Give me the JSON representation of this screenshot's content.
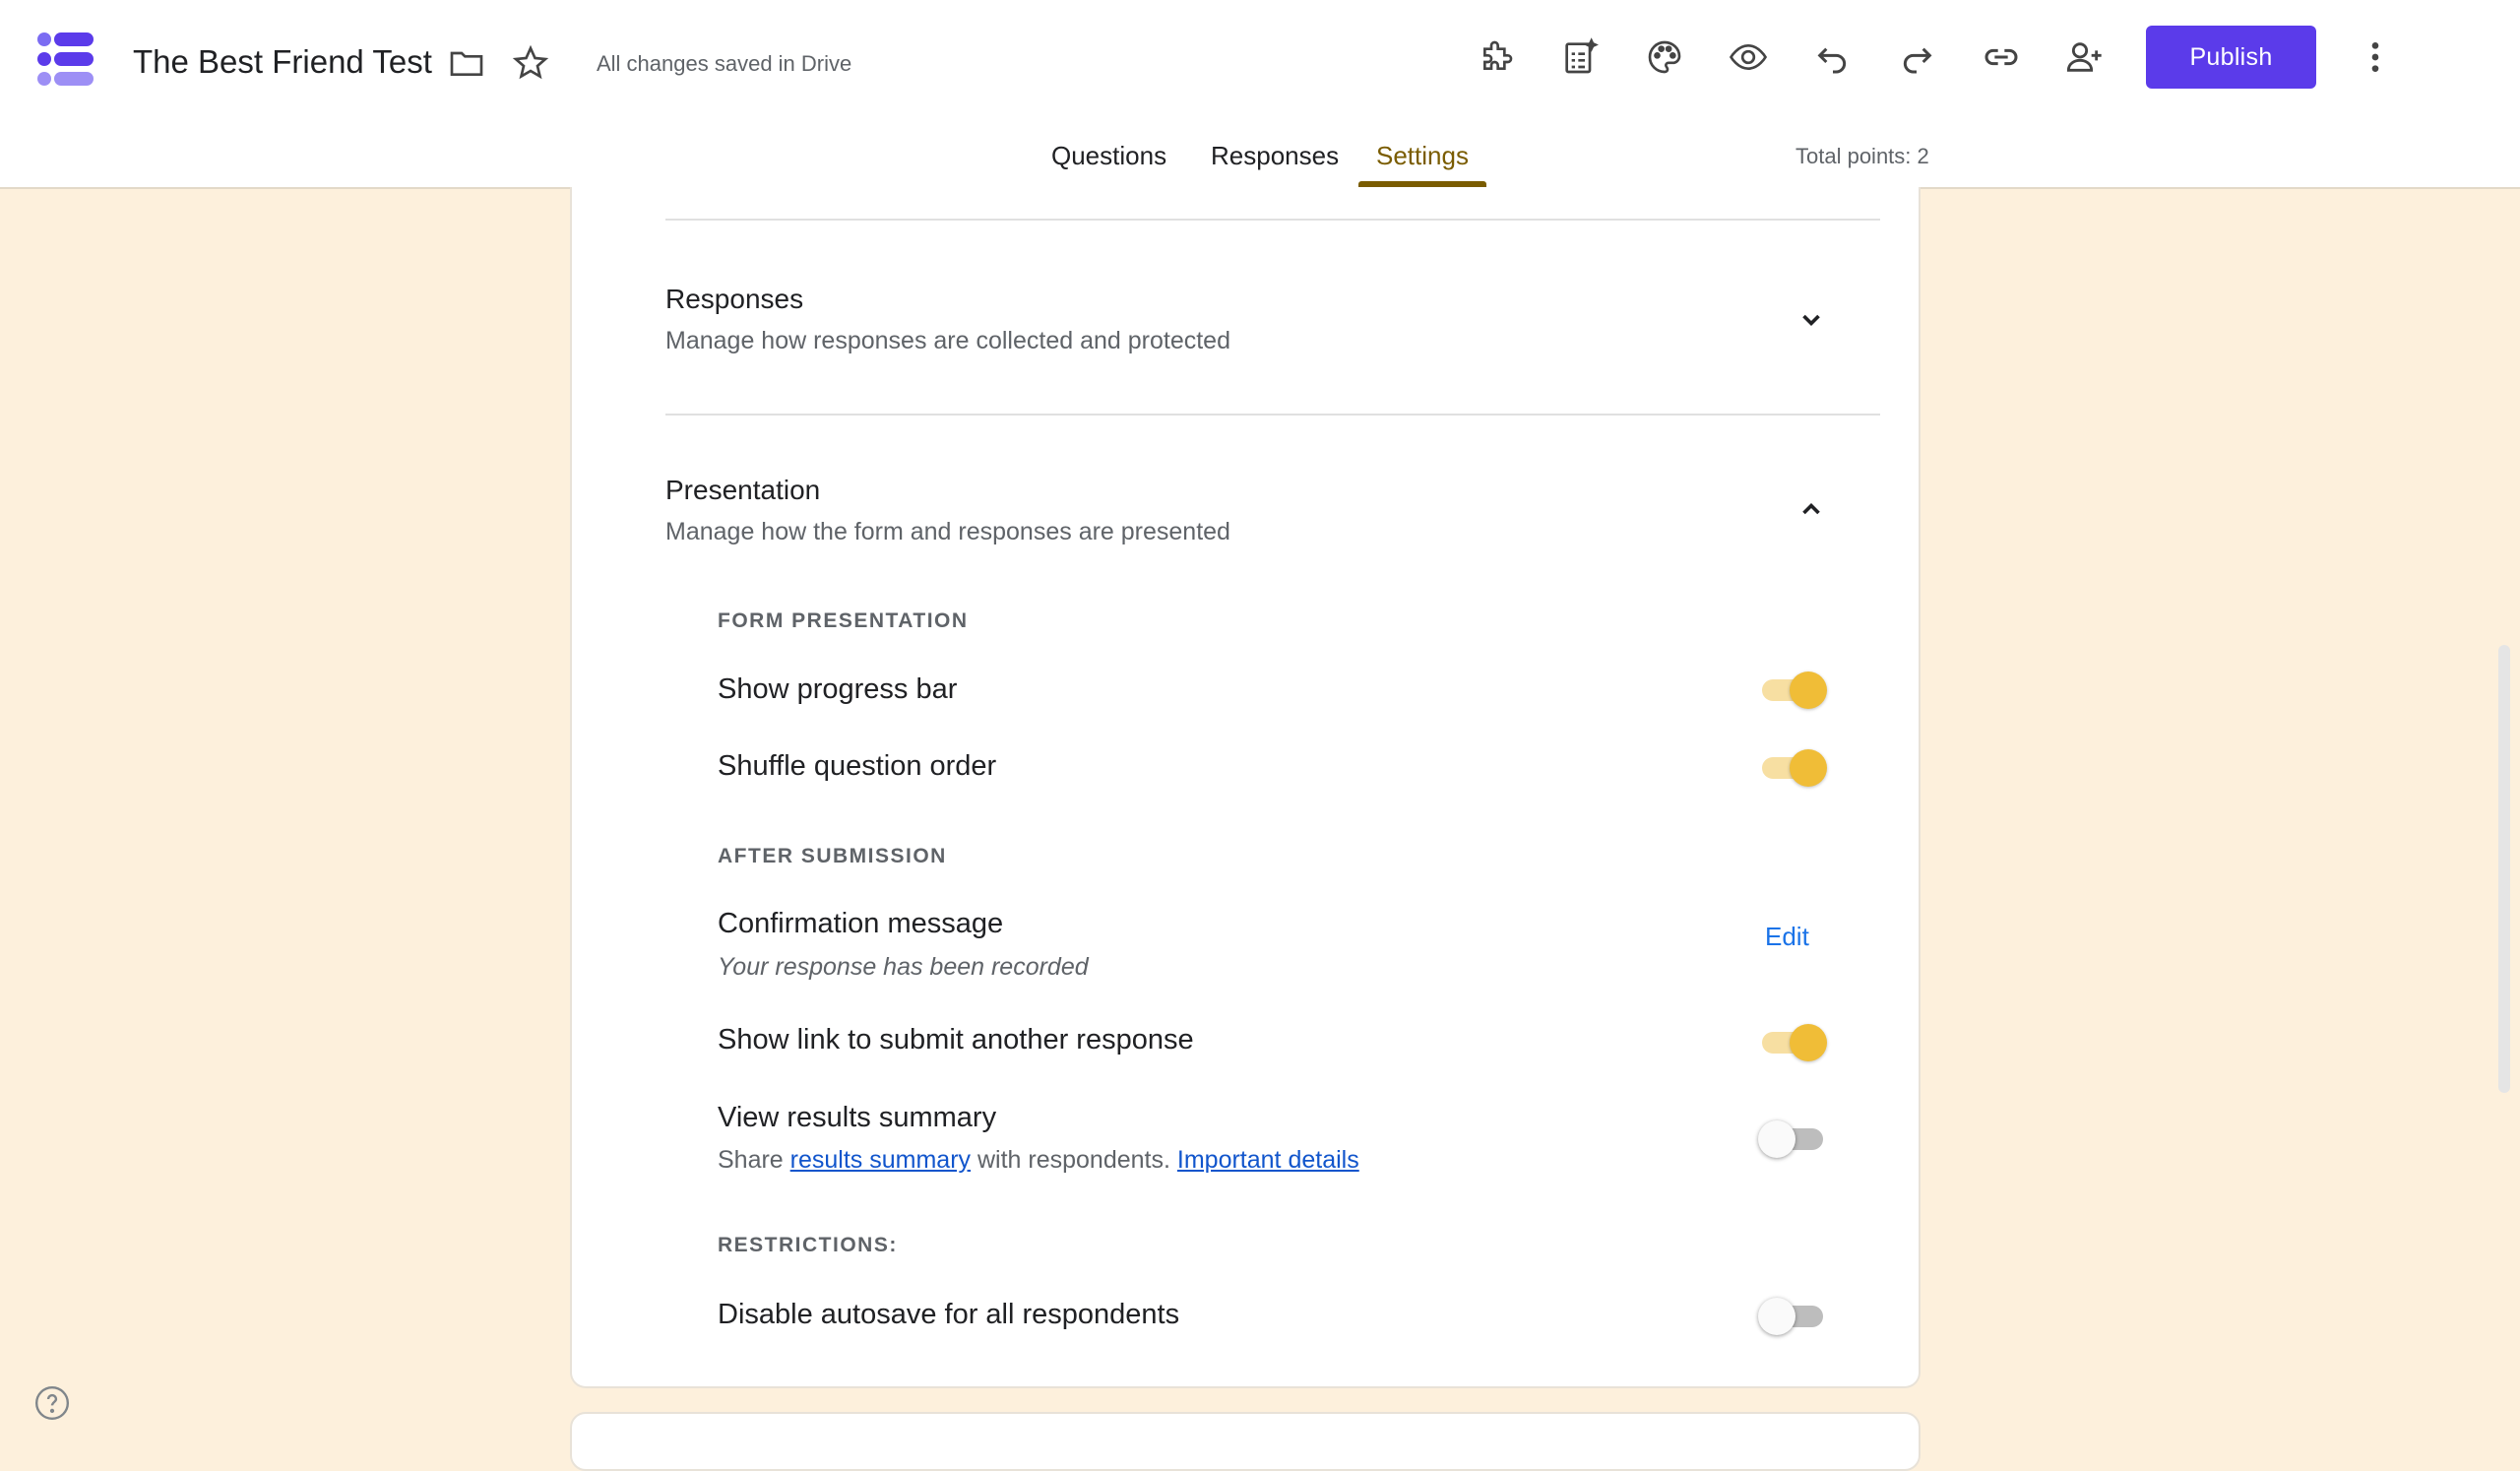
{
  "header": {
    "title": "The Best Friend Test",
    "save_status": "All changes saved in Drive",
    "publish_label": "Publish",
    "total_points": "Total points: 2"
  },
  "tabs": [
    {
      "label": "Questions",
      "active": false
    },
    {
      "label": "Responses",
      "active": false
    },
    {
      "label": "Settings",
      "active": true
    }
  ],
  "sections": {
    "responses": {
      "title": "Responses",
      "subtitle": "Manage how responses are collected and protected",
      "expanded": false
    },
    "presentation": {
      "title": "Presentation",
      "subtitle": "Manage how the form and responses are presented",
      "expanded": true
    }
  },
  "presentation": {
    "form_presentation_label": "FORM PRESENTATION",
    "show_progress_bar": {
      "label": "Show progress bar",
      "enabled": true
    },
    "shuffle_question_order": {
      "label": "Shuffle question order",
      "enabled": true
    },
    "after_submission_label": "AFTER SUBMISSION",
    "confirmation_message": {
      "label": "Confirmation message",
      "value": "Your response has been recorded",
      "edit_label": "Edit"
    },
    "show_link": {
      "label": "Show link to submit another response",
      "enabled": true
    },
    "view_results": {
      "label": "View results summary",
      "sub_prefix": "Share ",
      "sub_link1": "results summary",
      "sub_middle": " with respondents. ",
      "sub_link2": "Important details",
      "enabled": false
    },
    "restrictions_label": "RESTRICTIONS:",
    "disable_autosave": {
      "label": "Disable autosave for all respondents",
      "enabled": false
    }
  },
  "colors": {
    "accent": "#5b3bea",
    "active_tab": "#7a5c00",
    "toggle_on": "#f0bd37",
    "background": "#fdf0dc"
  },
  "icons": [
    "forms-logo",
    "folder-icon",
    "star-icon",
    "addon-puzzle-icon",
    "ai-form-icon",
    "palette-icon",
    "preview-eye-icon",
    "undo-icon",
    "redo-icon",
    "link-icon",
    "add-collaborator-icon",
    "more-vert-icon",
    "chevron-down-icon",
    "chevron-up-icon",
    "help-icon"
  ]
}
